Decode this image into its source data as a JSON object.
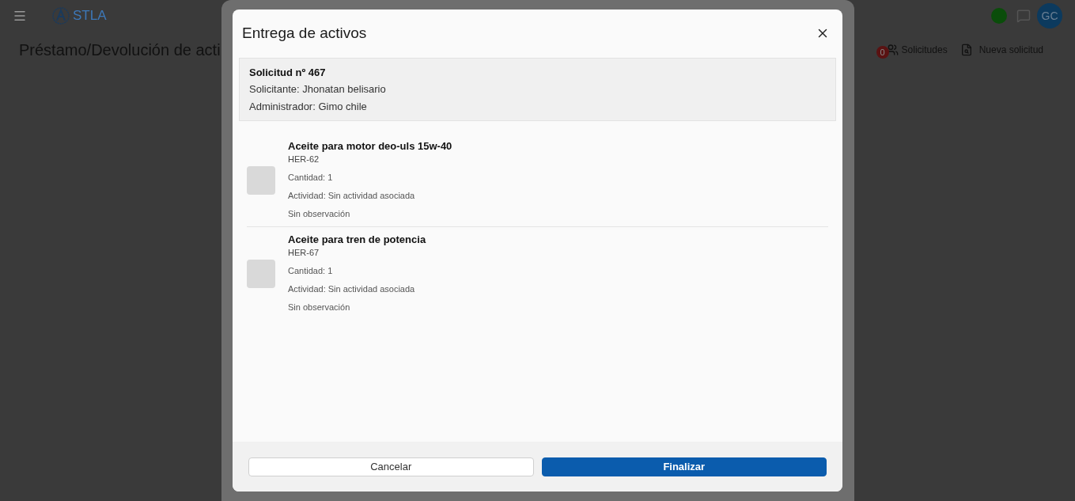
{
  "header": {
    "brand": "STLA",
    "avatar": "GC"
  },
  "page": {
    "title": "Préstamo/Devolución de acti",
    "requests_badge": "0",
    "requests_label": "Solicitudes",
    "new_request_label": "Nueva solicitud"
  },
  "dialog": {
    "title": "Entrega de activos",
    "request": {
      "number": "Solicitud nº 467",
      "requester": "Solicitante: Jhonatan belisario",
      "administrator": "Administrador: Gimo chile"
    },
    "items": [
      {
        "name": "Aceite para motor deo-uls 15w-40",
        "code": "HER-62",
        "quantity": "Cantidad: 1",
        "activity": "Actividad: Sin actividad asociada",
        "observation": "Sin observación"
      },
      {
        "name": "Aceite para tren de potencia",
        "code": "HER-67",
        "quantity": "Cantidad: 1",
        "activity": "Actividad: Sin actividad asociada",
        "observation": "Sin observación"
      }
    ],
    "buttons": [
      {
        "label": "Cancelar",
        "kind": "secondary"
      },
      {
        "label": "Finalizar",
        "kind": "primary"
      }
    ]
  }
}
